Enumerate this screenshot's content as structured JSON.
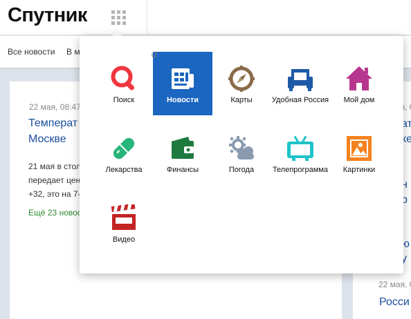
{
  "header": {
    "logo": "Спутник",
    "grid_icon": "apps-grid-icon"
  },
  "subnav": {
    "items": [
      {
        "label": "Все новости"
      },
      {
        "label": "В м"
      }
    ]
  },
  "left_card": {
    "date": "22 мая, 08:47",
    "headline_line1": "Температ",
    "headline_line2": "Москве",
    "snippet_lines": [
      "21 мая в стол",
      "передает цен",
      "+32, это на 7-"
    ],
    "more": "Ещё 23 новос"
  },
  "right_card": {
    "meta_top": "22 мая, 0",
    "text_fragments": [
      "ать",
      "ке",
      "н",
      "р",
      "ю",
      "у"
    ],
    "meta_bottom": "22 мая, 0",
    "headline_bottom": "Росси"
  },
  "popup": {
    "back_icon": "undo-arrow-icon",
    "services": [
      {
        "label": "Поиск",
        "icon": "search-icon",
        "color": "#f0363f"
      },
      {
        "label": "Новости",
        "icon": "newspaper-icon",
        "color": "#1a66c0",
        "active": true
      },
      {
        "label": "Карты",
        "icon": "compass-icon",
        "color": "#8a6a48"
      },
      {
        "label": "Удобная Россия",
        "icon": "armchair-icon",
        "color": "#1e5aa8"
      },
      {
        "label": "Мой дом",
        "icon": "house-icon",
        "color": "#b8378e"
      },
      {
        "label": "Лекарства",
        "icon": "pill-icon",
        "color": "#27b57a"
      },
      {
        "label": "Финансы",
        "icon": "wallet-icon",
        "color": "#1e7a3e"
      },
      {
        "label": "Погода",
        "icon": "weather-icon",
        "color": "#8a9bb0"
      },
      {
        "label": "Телепрограмма",
        "icon": "tv-icon",
        "color": "#1ec3c8"
      },
      {
        "label": "Картинки",
        "icon": "picture-icon",
        "color": "#f5821f"
      },
      {
        "label": "Видео",
        "icon": "clapperboard-icon",
        "color": "#c42424"
      }
    ]
  }
}
